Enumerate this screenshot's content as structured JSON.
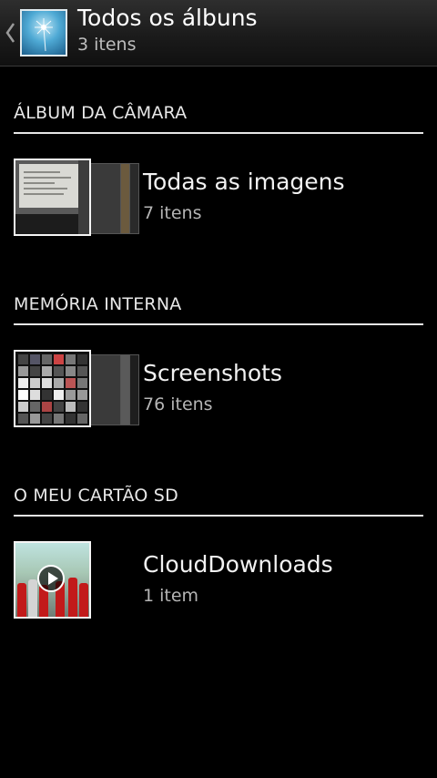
{
  "header": {
    "title": "Todos os álbuns",
    "subtitle": "3 itens",
    "back_icon": "chevron-left-icon",
    "app_icon": "dandelion-thumbnail"
  },
  "sections": [
    {
      "label": "ÁLBUM DA CÂMARA",
      "album": {
        "title": "Todas as imagens",
        "count": "7 itens"
      }
    },
    {
      "label": "MEMÓRIA INTERNA",
      "album": {
        "title": "Screenshots",
        "count": "76 itens"
      }
    },
    {
      "label": "O MEU CARTÃO SD",
      "album": {
        "title": "CloudDownloads",
        "count": "1 item"
      }
    }
  ],
  "colors": {
    "background": "#000000",
    "rule": "#e6e6e6",
    "secondary_text": "#b5b5b5"
  }
}
